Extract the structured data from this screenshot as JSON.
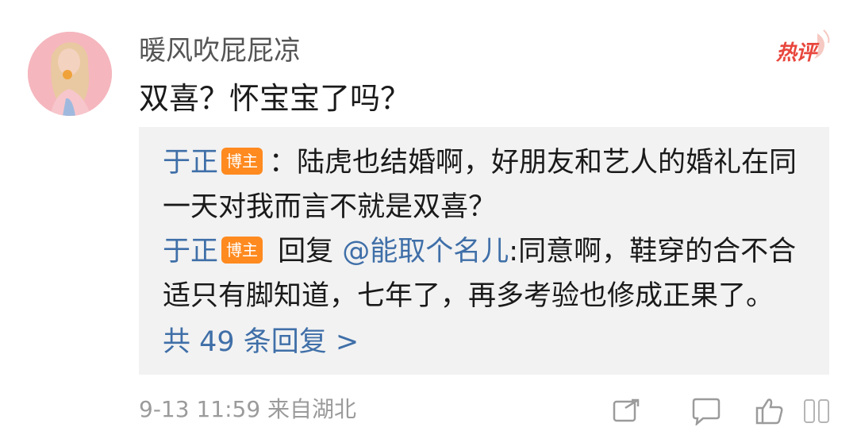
{
  "comment": {
    "username": "暖风吹屁屁凉",
    "hot_label": "热评",
    "text": "双喜？怀宝宝了吗？",
    "meta": "9-13 11:59 来自湖北"
  },
  "reply_box": {
    "reply1": {
      "author": "于正",
      "badge": "博主",
      "line1": "：陆虎也结婚啊，好朋友和艺人的婚礼在同",
      "line2": "一天对我而言不就是双喜？"
    },
    "reply2": {
      "author": "于正",
      "badge": "博主",
      "reply_word": " 回复 ",
      "mention": "@能取个名儿",
      "line1_rest": ":同意啊，鞋穿的合不合",
      "line2": "适只有脚知道，七年了，再多考验也修成正果了。"
    },
    "more_replies": "共 49 条回复 >"
  },
  "icons": {
    "avatar": "user-avatar",
    "share": "share-icon",
    "comment": "comment-icon",
    "like": "like-icon"
  }
}
